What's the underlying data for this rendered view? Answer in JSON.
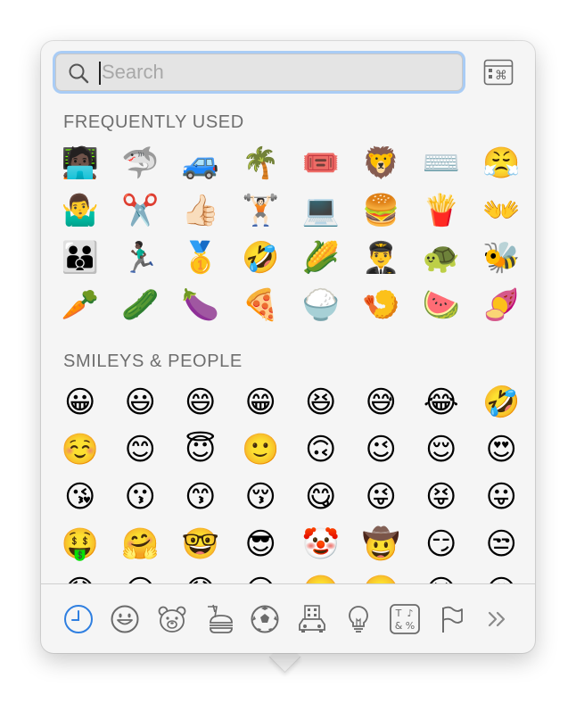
{
  "search": {
    "placeholder": "Search",
    "value": ""
  },
  "sections": [
    {
      "title": "FREQUENTLY USED",
      "emojis": [
        "🧑🏿‍💻",
        "🦈",
        "🚙",
        "🌴",
        "🎟️",
        "🦁",
        "⌨️",
        "😤",
        "🤷‍♂️",
        "✂️",
        "👍🏻",
        "🏋🏻",
        "💻",
        "🍔",
        "🍟",
        "👐",
        "👨‍👨‍👦",
        "🏃🏿‍♂️",
        "🥇",
        "🤣",
        "🌽",
        "👨‍✈️",
        "🐢",
        "🐝",
        "🥕",
        "🥒",
        "🍆",
        "🍕",
        "🍚",
        "🍤",
        "🍉",
        "🍠"
      ]
    },
    {
      "title": "SMILEYS & PEOPLE",
      "emojis": [
        "😀",
        "😃",
        "😄",
        "😁",
        "😆",
        "😅",
        "😂",
        "🤣",
        "☺️",
        "😊",
        "😇",
        "🙂",
        "🙃",
        "😉",
        "😌",
        "😍",
        "😘",
        "😗",
        "😙",
        "😚",
        "😋",
        "😜",
        "😝",
        "😛",
        "🤑",
        "🤗",
        "🤓",
        "😎",
        "🤡",
        "🤠",
        "😏",
        "😒",
        "😞",
        "😔",
        "😟",
        "😕",
        "🙁",
        "☹️",
        "😣",
        "😖"
      ]
    }
  ],
  "tabs": [
    {
      "name": "recent",
      "selected": true
    },
    {
      "name": "smileys",
      "selected": false
    },
    {
      "name": "animals",
      "selected": false
    },
    {
      "name": "food",
      "selected": false
    },
    {
      "name": "activity",
      "selected": false
    },
    {
      "name": "travel",
      "selected": false
    },
    {
      "name": "objects",
      "selected": false
    },
    {
      "name": "symbols",
      "selected": false
    },
    {
      "name": "flags",
      "selected": false
    },
    {
      "name": "more",
      "selected": false
    }
  ],
  "colors": {
    "accent": "#2f7fe0",
    "focus_ring": "#a9ccf5",
    "icon": "#6b6b6b",
    "panel": "#f5f5f5",
    "section_title": "#6e6e6e"
  }
}
